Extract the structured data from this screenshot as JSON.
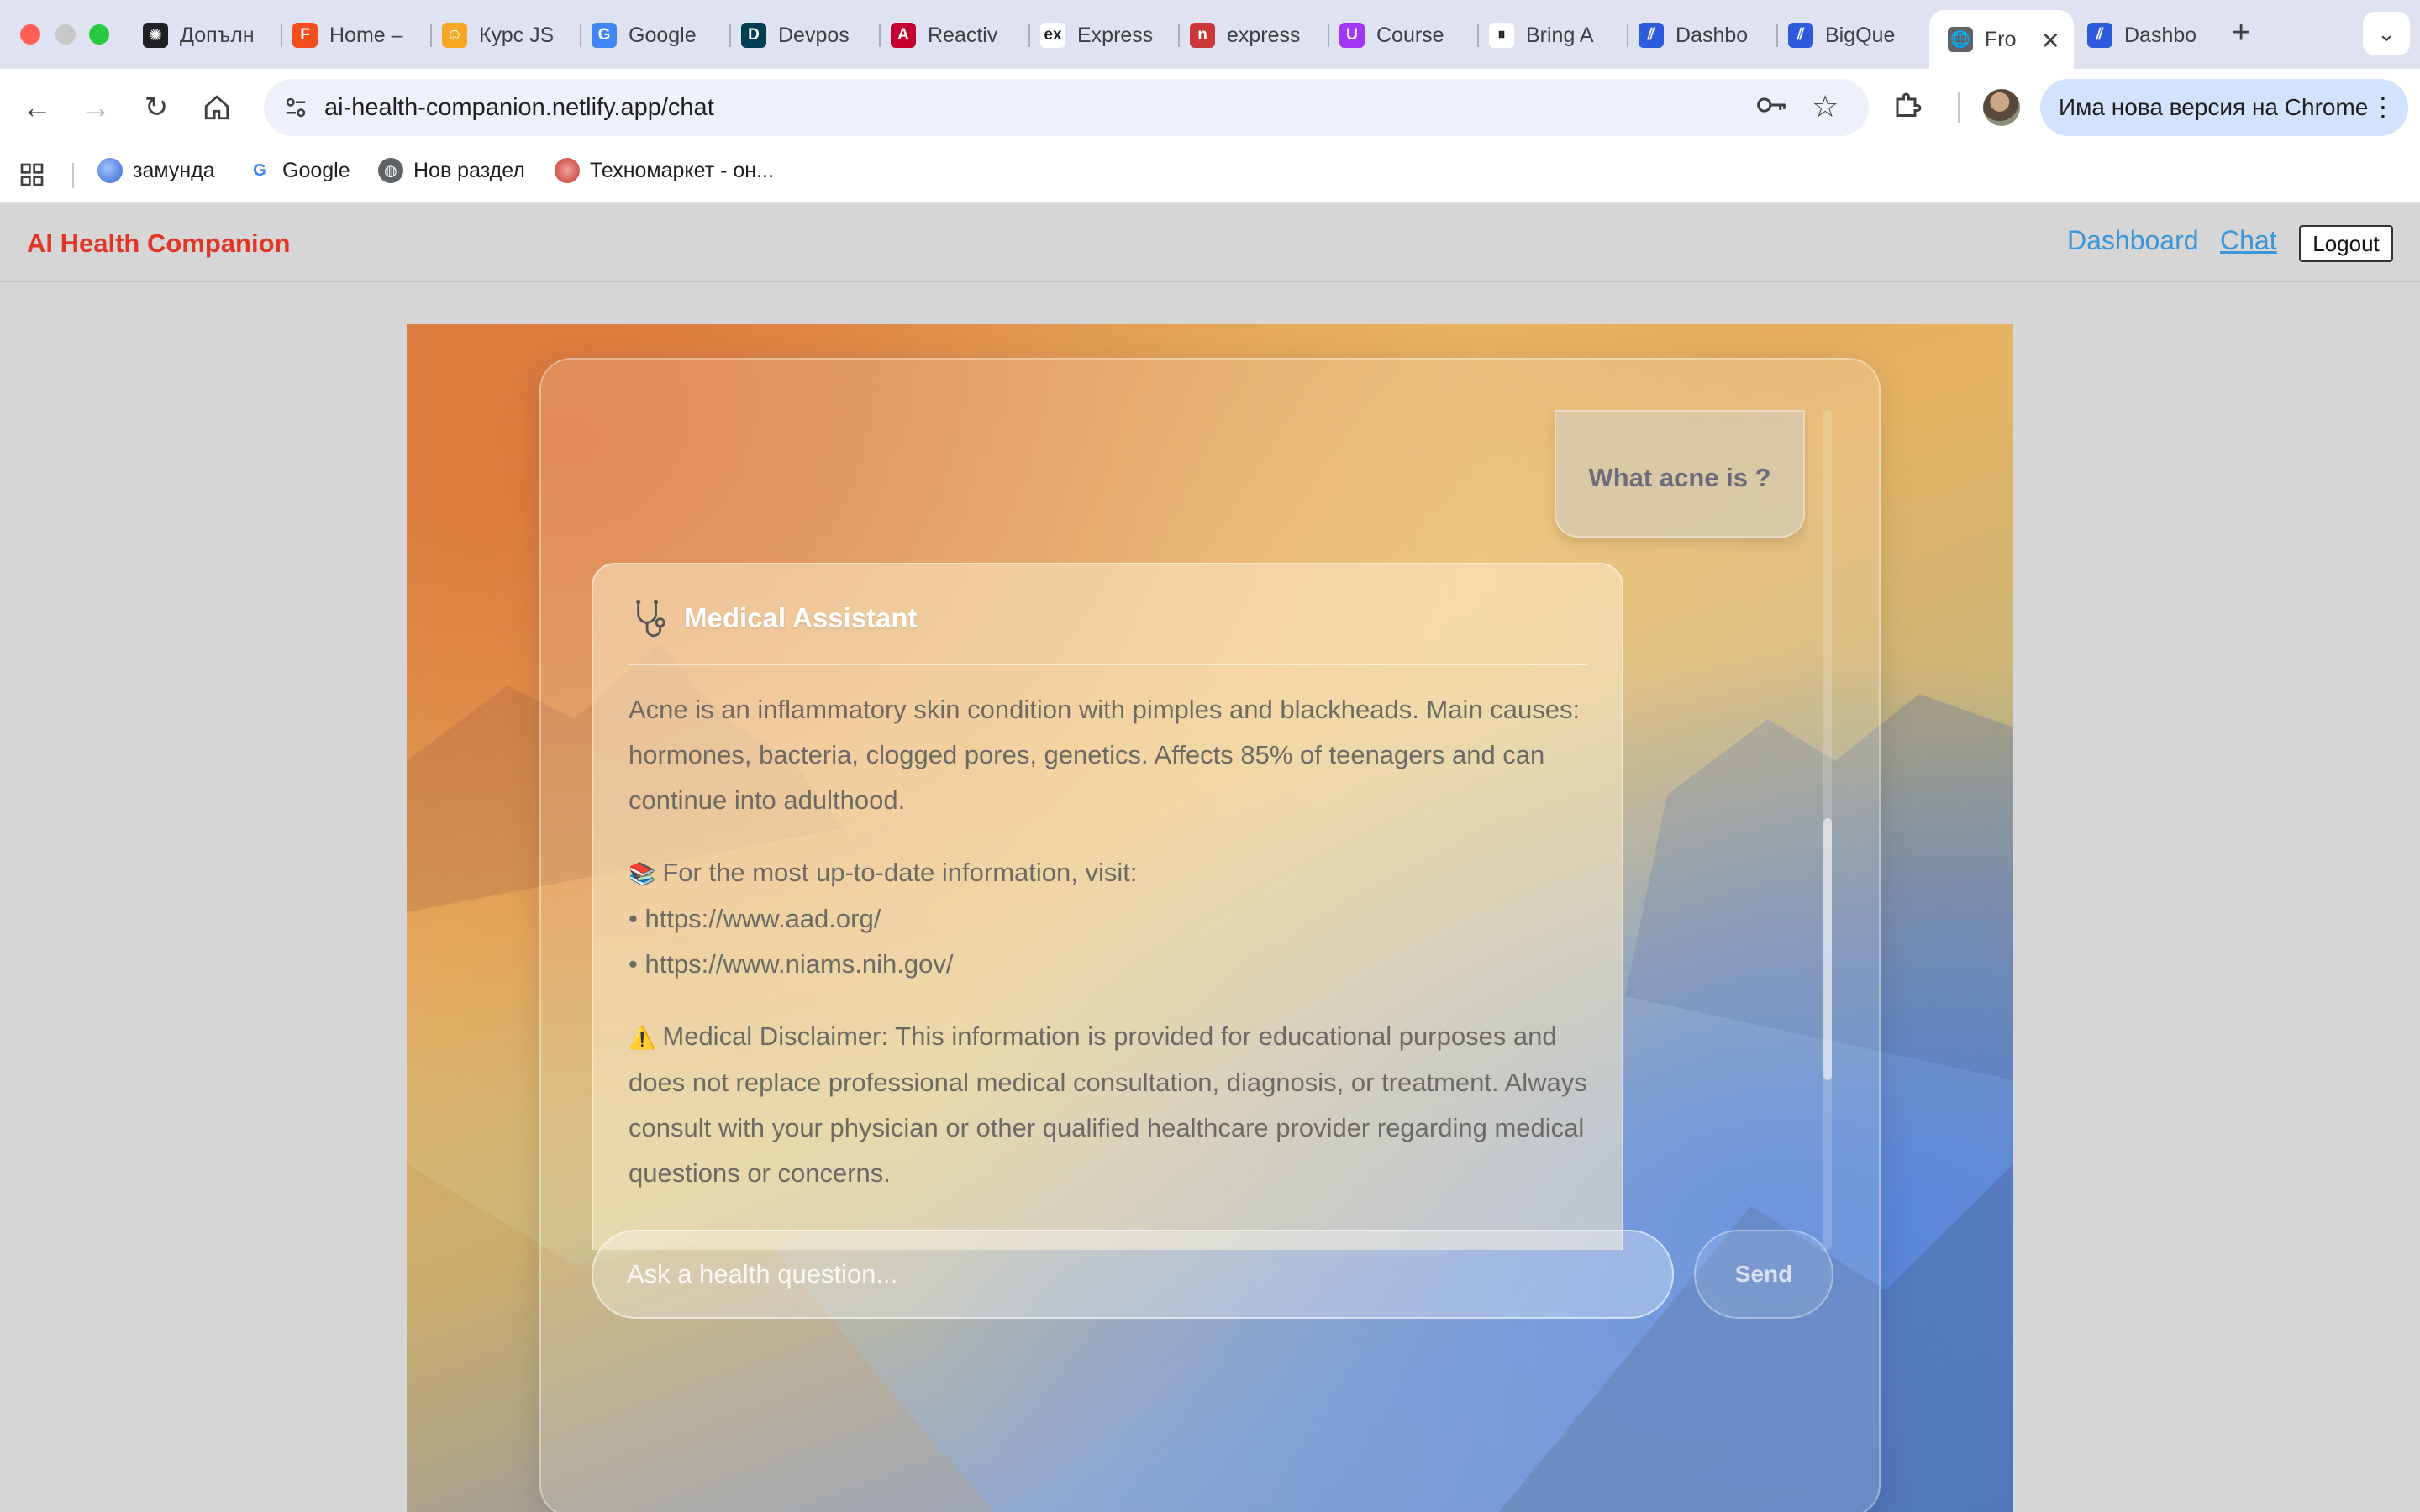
{
  "browser": {
    "tabs": [
      {
        "title": "Допълн",
        "icon": "openai-icon",
        "icon_color": "#202124",
        "glyph": "✺"
      },
      {
        "title": "Home –",
        "icon": "figma-icon",
        "icon_color": "#f24e1e",
        "glyph": "F"
      },
      {
        "title": "Курс JS",
        "icon": "course-icon",
        "icon_color": "#f5a623",
        "glyph": "☺"
      },
      {
        "title": "Google",
        "icon": "google-translate-icon",
        "icon_color": "#4285f4",
        "glyph": "G"
      },
      {
        "title": "Devpos",
        "icon": "devpost-icon",
        "icon_color": "#003e54",
        "glyph": "D"
      },
      {
        "title": "Reactiv",
        "icon": "angular-icon",
        "icon_color": "#c3002f",
        "glyph": "A"
      },
      {
        "title": "Express",
        "icon": "express-icon",
        "icon_color": "#ffffff",
        "glyph": "ex"
      },
      {
        "title": "express",
        "icon": "npm-icon",
        "icon_color": "#cb3837",
        "glyph": "n"
      },
      {
        "title": "Course",
        "icon": "udemy-icon",
        "icon_color": "#a435f0",
        "glyph": "U"
      },
      {
        "title": "Bring A",
        "icon": "pause-icon",
        "icon_color": "#ffffff",
        "glyph": "⏸"
      },
      {
        "title": "Dashbo",
        "icon": "vercel-icon",
        "icon_color": "#2e5bdb",
        "glyph": "⫽"
      },
      {
        "title": "BigQue",
        "icon": "vercel-icon",
        "icon_color": "#2e5bdb",
        "glyph": "⫽"
      },
      {
        "title": "Fro",
        "icon": "globe-icon",
        "icon_color": "#5f6368",
        "glyph": "🌐"
      },
      {
        "title": "Dashbo",
        "icon": "vercel-icon",
        "icon_color": "#2e5bdb",
        "glyph": "⫽"
      }
    ],
    "active_tab_index": 12,
    "url": "ai-health-companion.netlify.app/chat",
    "update_label": "Има нова версия на Chrome",
    "bookmarks": [
      {
        "label": "замунда",
        "icon": "zamunda-icon"
      },
      {
        "label": "Google",
        "icon": "google-icon"
      },
      {
        "label": "Нов раздел",
        "icon": "globe-icon"
      },
      {
        "label": "Техномаркет - он...",
        "icon": "technomarket-icon"
      }
    ]
  },
  "app": {
    "brand": "AI Health Companion",
    "brand_color": "#e03628",
    "nav": {
      "dashboard": "Dashboard",
      "chat": "Chat",
      "logout": "Logout"
    },
    "link_color": "#3b96d9"
  },
  "chat": {
    "user_message": "What acne is ?",
    "assistant": {
      "name": "Medical Assistant",
      "paragraph_1": "Acne is an inflammatory skin condition with pimples and blackheads. Main causes: hormones, bacteria, clogged pores, genetics. Affects 85% of teenagers and can continue into adulthood.",
      "sources_intro": "For the most up-to-date information, visit:",
      "links": [
        "• https://www.aad.org/",
        "• https://www.niams.nih.gov/"
      ],
      "disclaimer": "Medical Disclaimer: This information is provided for educational purposes and does not replace professional medical consultation, diagnosis, or treatment. Always consult with your physician or other qualified healthcare provider regarding medical questions or concerns."
    },
    "input_placeholder": "Ask a health question...",
    "send_label": "Send"
  }
}
